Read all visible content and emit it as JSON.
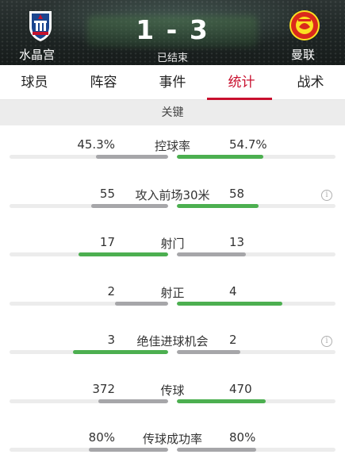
{
  "match": {
    "home_team": "水晶宫",
    "away_team": "曼联",
    "score": "1 - 3",
    "status": "已结束"
  },
  "tabs": [
    {
      "label": "球员",
      "active": false
    },
    {
      "label": "阵容",
      "active": false
    },
    {
      "label": "事件",
      "active": false
    },
    {
      "label": "统计",
      "active": true
    },
    {
      "label": "战术",
      "active": false
    }
  ],
  "section_title": "关键",
  "colors": {
    "accent": "#c8102e",
    "leader_bar": "#4caf50",
    "trailer_bar": "#a6a6a9"
  },
  "stats": [
    {
      "label": "控球率",
      "home": "45.3%",
      "away": "54.7%",
      "home_value": 45.3,
      "away_value": 54.7,
      "info": false
    },
    {
      "label": "攻入前场30米",
      "home": "55",
      "away": "58",
      "home_value": 55,
      "away_value": 58,
      "info": true
    },
    {
      "label": "射门",
      "home": "17",
      "away": "13",
      "home_value": 17,
      "away_value": 13,
      "info": false
    },
    {
      "label": "射正",
      "home": "2",
      "away": "4",
      "home_value": 2,
      "away_value": 4,
      "info": false
    },
    {
      "label": "绝佳进球机会",
      "home": "3",
      "away": "2",
      "home_value": 3,
      "away_value": 2,
      "info": true
    },
    {
      "label": "传球",
      "home": "372",
      "away": "470",
      "home_value": 372,
      "away_value": 470,
      "info": false
    },
    {
      "label": "传球成功率",
      "home": "80%",
      "away": "80%",
      "home_value": 80,
      "away_value": 80,
      "info": false
    }
  ]
}
